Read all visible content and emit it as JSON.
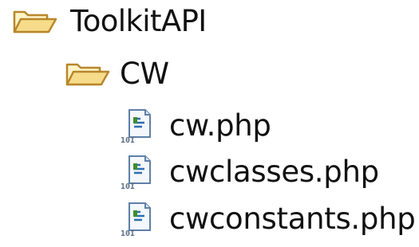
{
  "tree": {
    "root": {
      "label": "ToolkitAPI",
      "icon": "folder-open-icon",
      "child": {
        "label": "CW",
        "icon": "folder-open-icon",
        "files": [
          {
            "label": "cw.php",
            "icon": "php-file-icon"
          },
          {
            "label": "cwclasses.php",
            "icon": "php-file-icon"
          },
          {
            "label": "cwconstants.php",
            "icon": "php-file-icon"
          }
        ]
      }
    }
  },
  "colors": {
    "folder_fill": "#f6dc8a",
    "folder_stroke": "#b8862b",
    "file_fill": "#f4f8fc",
    "file_stroke": "#5f7fa8",
    "file_accent": "#3f8e2f"
  }
}
